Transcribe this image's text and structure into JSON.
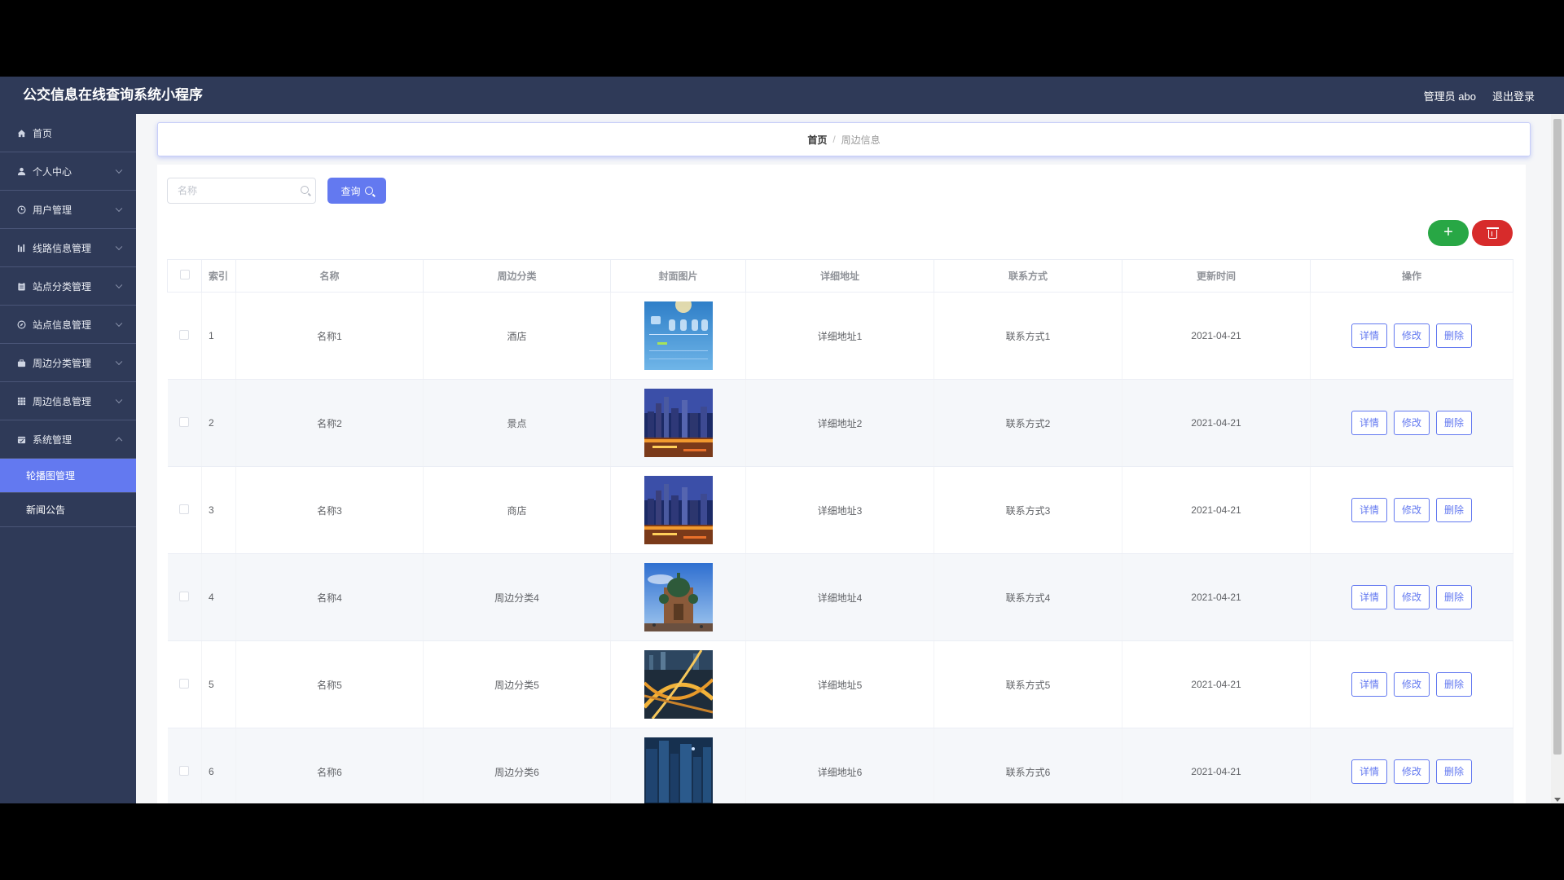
{
  "header": {
    "title": "公交信息在线查询系统小程序",
    "user_label": "管理员 abo",
    "logout_label": "退出登录"
  },
  "sidebar": {
    "items": [
      {
        "label": "首页",
        "icon": "home-icon",
        "has_submenu": false
      },
      {
        "label": "个人中心",
        "icon": "user-icon",
        "has_submenu": true
      },
      {
        "label": "用户管理",
        "icon": "clock-icon",
        "has_submenu": true
      },
      {
        "label": "线路信息管理",
        "icon": "bar-chart-icon",
        "has_submenu": true
      },
      {
        "label": "站点分类管理",
        "icon": "clipboard-icon",
        "has_submenu": true
      },
      {
        "label": "站点信息管理",
        "icon": "compass-icon",
        "has_submenu": true
      },
      {
        "label": "周边分类管理",
        "icon": "briefcase-icon",
        "has_submenu": true
      },
      {
        "label": "周边信息管理",
        "icon": "grid-icon",
        "has_submenu": true
      },
      {
        "label": "系统管理",
        "icon": "calendar-icon",
        "has_submenu": true,
        "expanded": true
      }
    ],
    "subitems": [
      {
        "label": "轮播图管理",
        "active": true
      },
      {
        "label": "新闻公告",
        "active": false
      }
    ]
  },
  "breadcrumb": {
    "home": "首页",
    "separator": "/",
    "current": "周边信息"
  },
  "search": {
    "placeholder": "名称",
    "value": "",
    "button_label": "查询"
  },
  "actions": {
    "add_label": "+"
  },
  "table": {
    "columns": [
      "索引",
      "名称",
      "周边分类",
      "封面图片",
      "详细地址",
      "联系方式",
      "更新时间",
      "操作"
    ],
    "row_actions": {
      "detail": "详情",
      "edit": "修改",
      "delete": "删除"
    },
    "rows": [
      {
        "index": "1",
        "name": "名称1",
        "category": "酒店",
        "image": "weather-app-screenshot",
        "address": "详细地址1",
        "contact": "联系方式1",
        "updated": "2021-04-21"
      },
      {
        "index": "2",
        "name": "名称2",
        "category": "景点",
        "image": "city-night-skyline",
        "address": "详细地址2",
        "contact": "联系方式2",
        "updated": "2021-04-21"
      },
      {
        "index": "3",
        "name": "名称3",
        "category": "商店",
        "image": "city-night-skyline",
        "address": "详细地址3",
        "contact": "联系方式3",
        "updated": "2021-04-21"
      },
      {
        "index": "4",
        "name": "名称4",
        "category": "周边分类4",
        "image": "domed-cathedral",
        "address": "详细地址4",
        "contact": "联系方式4",
        "updated": "2021-04-21"
      },
      {
        "index": "5",
        "name": "名称5",
        "category": "周边分类5",
        "image": "highway-interchange-night",
        "address": "详细地址5",
        "contact": "联系方式5",
        "updated": "2021-04-21"
      },
      {
        "index": "6",
        "name": "名称6",
        "category": "周边分类6",
        "image": "blue-city-towers",
        "address": "详细地址6",
        "contact": "联系方式6",
        "updated": "2021-04-21"
      }
    ]
  },
  "colors": {
    "sidebar_bg": "#2f3a58",
    "accent": "#6379f0",
    "add_green": "#28a745",
    "delete_red": "#d72b2b"
  }
}
